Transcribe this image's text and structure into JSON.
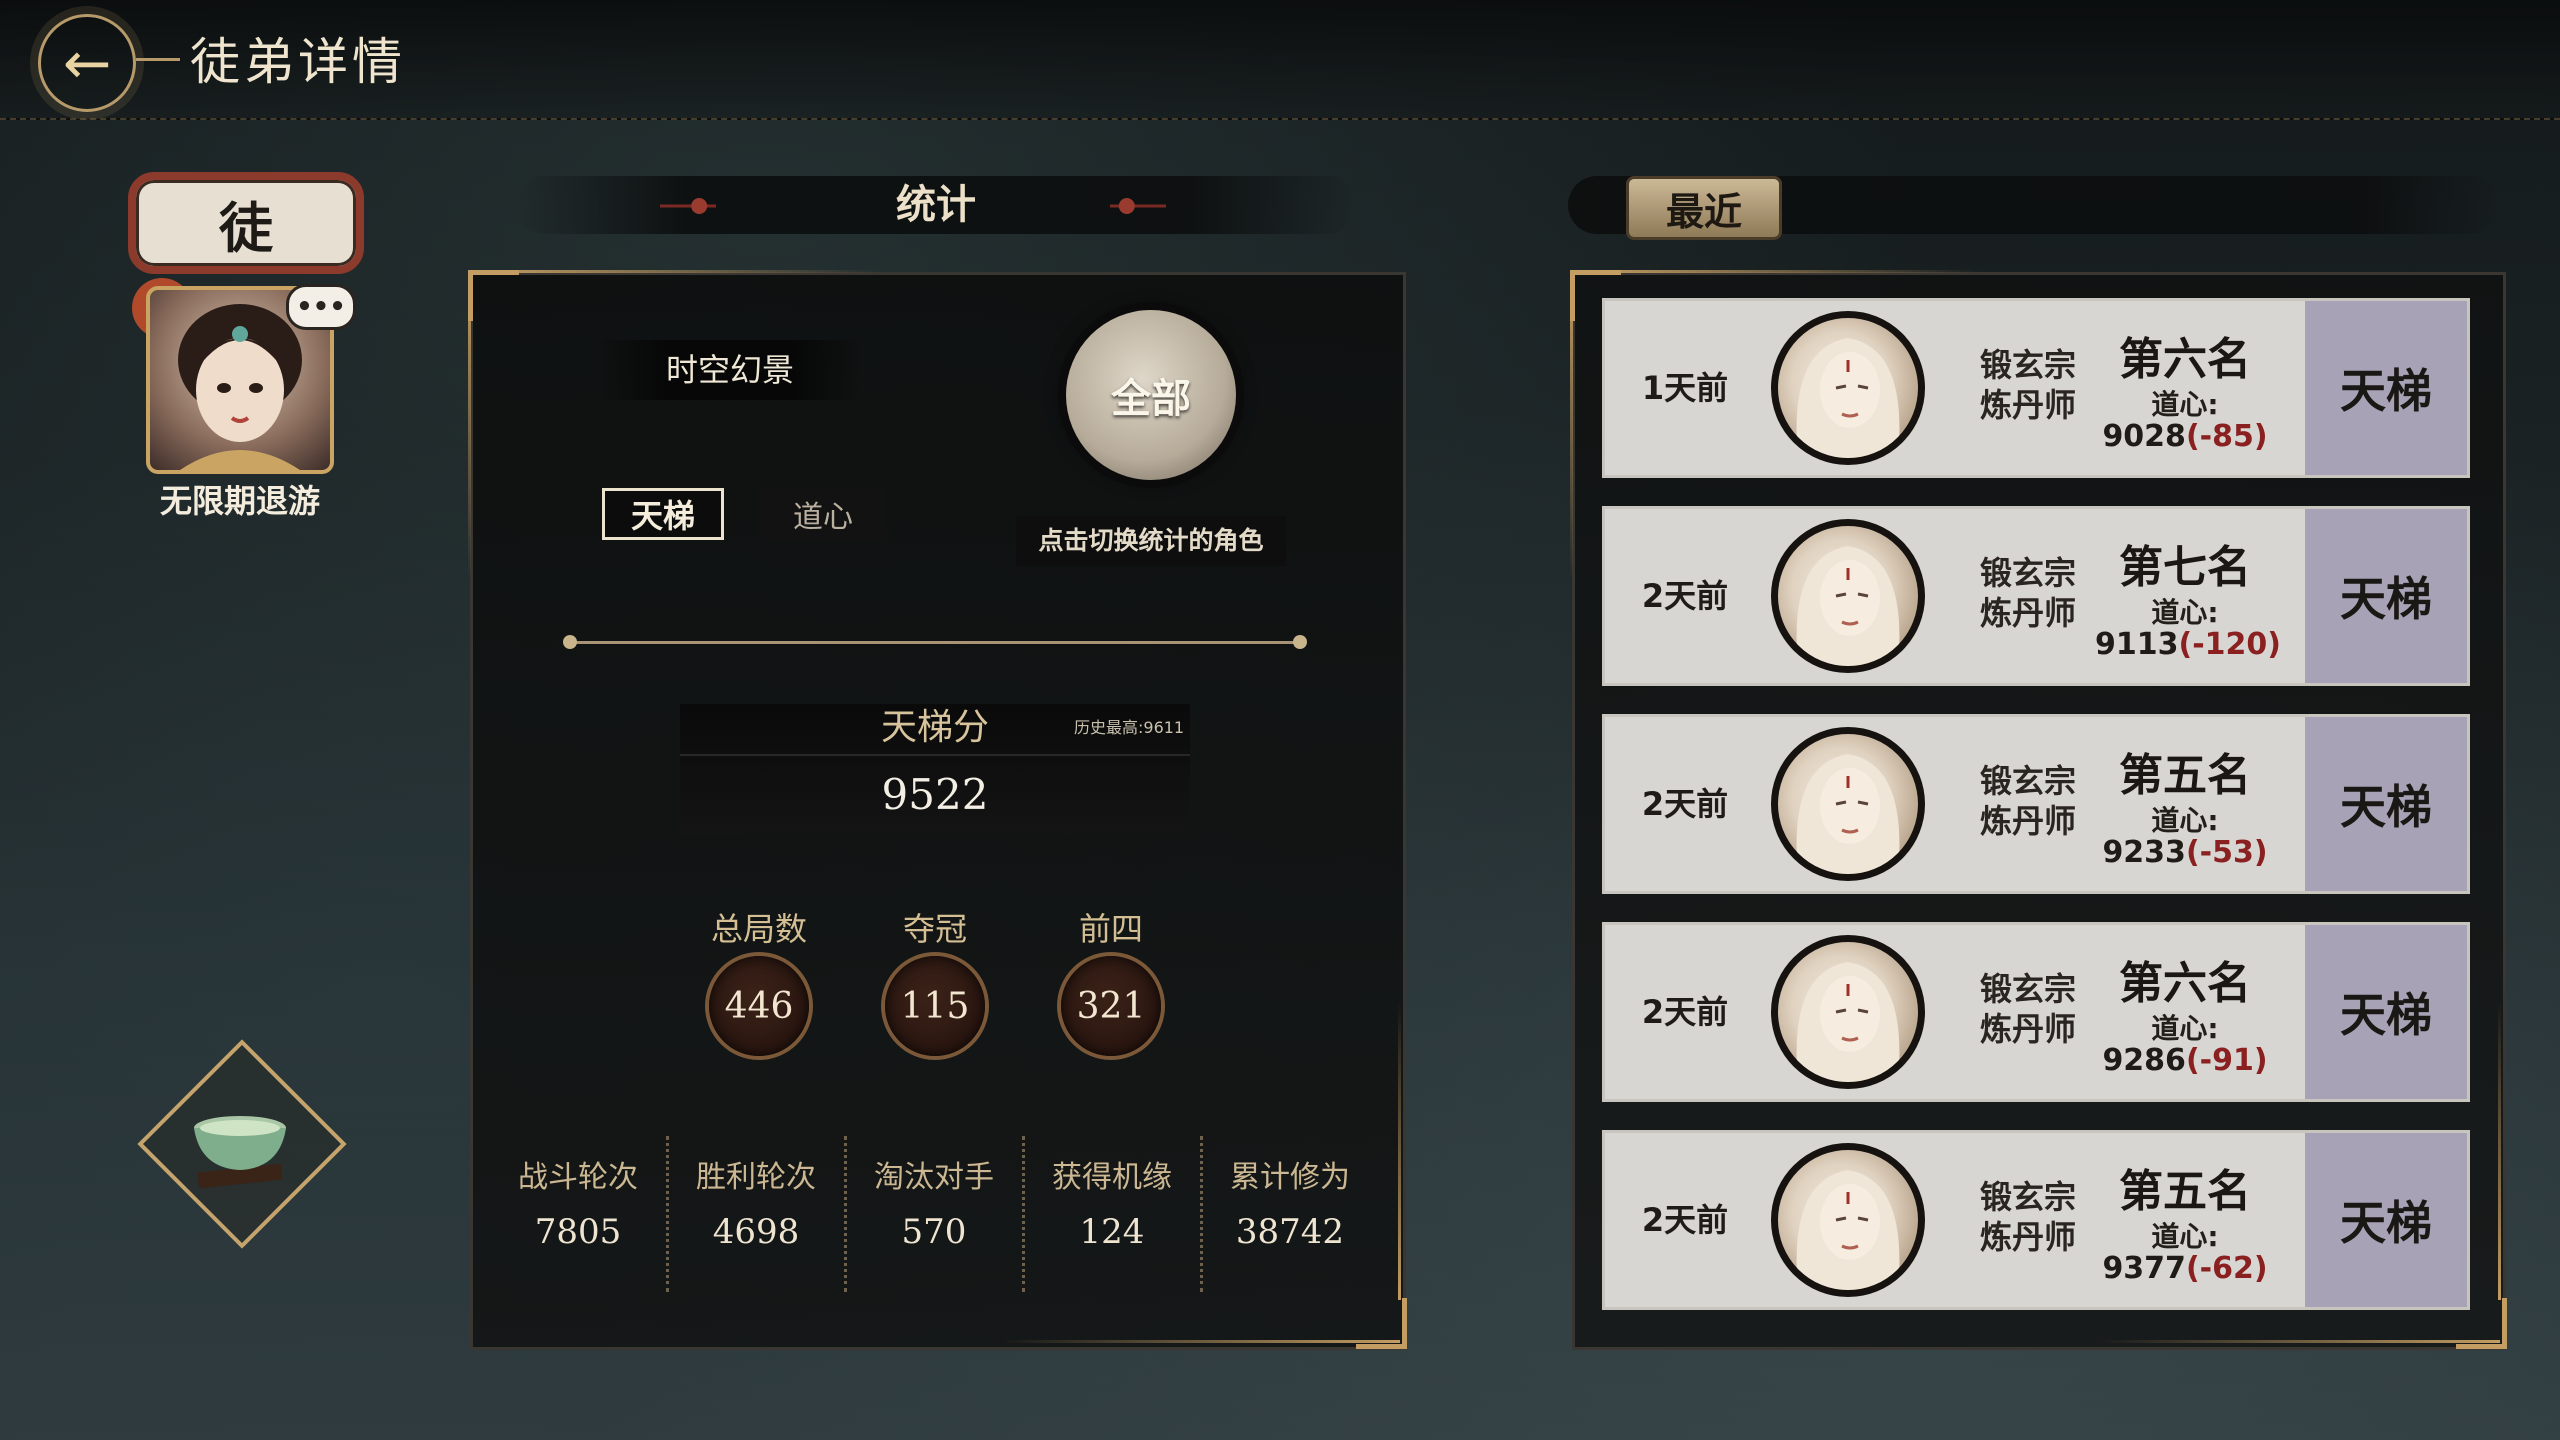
{
  "header": {
    "title": "徒弟详情"
  },
  "left": {
    "badge": "徒",
    "chat_icon": "•••",
    "player_name": "无限期退游"
  },
  "stats": {
    "section_title": "统计",
    "scene": "时空幻景",
    "tabs": [
      "天梯",
      "道心"
    ],
    "active_tab": "天梯",
    "all_button": "全部",
    "switch_hint": "点击切换统计的角色",
    "ladder": {
      "title": "天梯分",
      "history_best": "历史最高:9611",
      "score": "9522"
    },
    "summary": [
      {
        "label": "总局数",
        "value": "446"
      },
      {
        "label": "夺冠",
        "value": "115"
      },
      {
        "label": "前四",
        "value": "321"
      }
    ],
    "details": [
      {
        "label": "战斗轮次",
        "value": "7805"
      },
      {
        "label": "胜利轮次",
        "value": "4698"
      },
      {
        "label": "淘汰对手",
        "value": "570"
      },
      {
        "label": "获得机缘",
        "value": "124"
      },
      {
        "label": "累计修为",
        "value": "38742"
      }
    ]
  },
  "recent": {
    "tab_label": "最近",
    "matches": [
      {
        "time": "1天前",
        "sect": "锻玄宗",
        "role": "炼丹师",
        "rank": "第六名",
        "dao_label": "道心:",
        "score": "9028",
        "delta": "(-85)",
        "mode": "天梯"
      },
      {
        "time": "2天前",
        "sect": "锻玄宗",
        "role": "炼丹师",
        "rank": "第七名",
        "dao_label": "道心:",
        "score": "9113",
        "delta": "(-120)",
        "mode": "天梯"
      },
      {
        "time": "2天前",
        "sect": "锻玄宗",
        "role": "炼丹师",
        "rank": "第五名",
        "dao_label": "道心:",
        "score": "9233",
        "delta": "(-53)",
        "mode": "天梯"
      },
      {
        "time": "2天前",
        "sect": "锻玄宗",
        "role": "炼丹师",
        "rank": "第六名",
        "dao_label": "道心:",
        "score": "9286",
        "delta": "(-91)",
        "mode": "天梯"
      },
      {
        "time": "2天前",
        "sect": "锻玄宗",
        "role": "炼丹师",
        "rank": "第五名",
        "dao_label": "道心:",
        "score": "9377",
        "delta": "(-62)",
        "mode": "天梯"
      }
    ]
  },
  "colors": {
    "gold": "#c39d62",
    "delta_red": "#8a2020",
    "mode_bg": "#a7a2b5"
  }
}
